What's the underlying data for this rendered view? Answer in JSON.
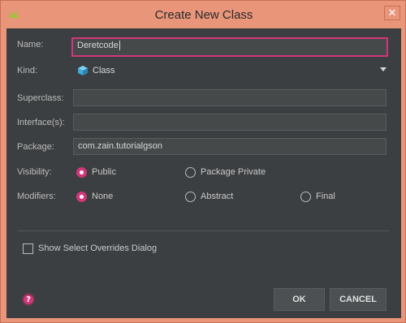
{
  "window": {
    "title": "Create New Class",
    "close_glyph": "✕"
  },
  "form": {
    "name_label": "Name:",
    "name_value": "Deretcode",
    "kind_label": "Kind:",
    "kind_value": "Class",
    "superclass_label": "Superclass:",
    "superclass_value": "",
    "interfaces_label": "Interface(s):",
    "interfaces_value": "",
    "package_label": "Package:",
    "package_value": "com.zain.tutorialgson",
    "visibility_label": "Visibility:",
    "visibility_options": [
      "Public",
      "Package Private"
    ],
    "visibility_selected": "Public",
    "modifiers_label": "Modifiers:",
    "modifiers_options": [
      "None",
      "Abstract",
      "Final"
    ],
    "modifiers_selected": "None",
    "show_overrides_label": "Show Select Overrides Dialog",
    "show_overrides_checked": false
  },
  "buttons": {
    "help_glyph": "?",
    "ok_label": "OK",
    "cancel_label": "CANCEL"
  },
  "colors": {
    "accent": "#d2367a",
    "dialog_bg": "#3c3f41",
    "frame": "#e8957a"
  },
  "icons": {
    "app": "android-icon",
    "kind": "class-cube-icon",
    "help": "help-icon",
    "close": "close-icon"
  }
}
